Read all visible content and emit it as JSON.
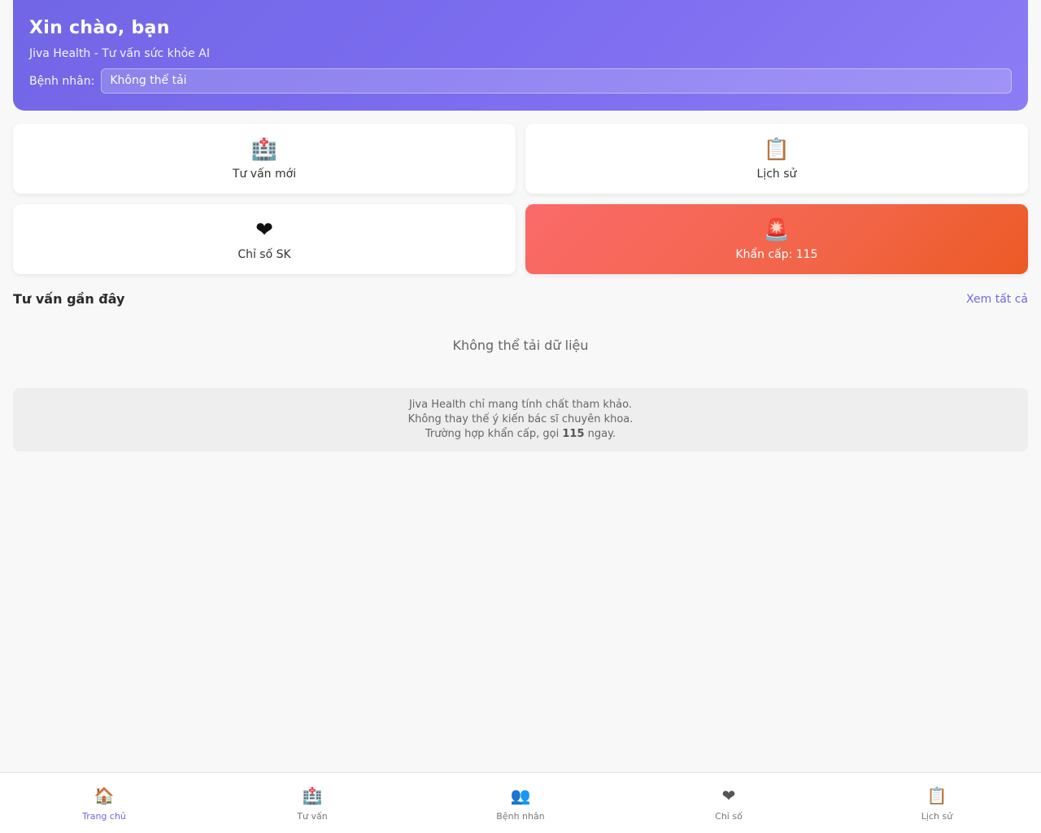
{
  "header": {
    "greeting": "Xin chào, bạn",
    "subtitle": "Jiva Health - Tư vấn sức khỏe AI",
    "patient_label": "Bệnh nhân:",
    "patient_value": "Không thể tải"
  },
  "actions": [
    {
      "icon": "🏥",
      "icon_name": "hospital-icon",
      "label": "Tư vấn mới"
    },
    {
      "icon": "📋",
      "icon_name": "clipboard-icon",
      "label": "Lịch sử"
    },
    {
      "icon": "❤",
      "icon_name": "heart-icon",
      "label": "Chỉ số SK"
    },
    {
      "icon": "🚨",
      "icon_name": "siren-icon",
      "label": "Khẩn cấp: 115"
    }
  ],
  "recent": {
    "title": "Tư vấn gần đây",
    "see_all": "Xem tất cả",
    "empty_message": "Không thể tải dữ liệu"
  },
  "disclaimer": {
    "line1": "Jiva Health chỉ mang tính chất tham khảo.",
    "line2": "Không thay thế ý kiến bác sĩ chuyên khoa.",
    "line3_pre": "Trường hợp khẩn cấp, gọi ",
    "line3_number": "115",
    "line3_post": " ngay."
  },
  "nav": [
    {
      "icon": "🏠",
      "icon_name": "home-icon",
      "label": "Trang chủ",
      "active": true
    },
    {
      "icon": "🏥",
      "icon_name": "hospital-icon",
      "label": "Tư vấn"
    },
    {
      "icon": "👥",
      "icon_name": "patients-icon",
      "label": "Bệnh nhân"
    },
    {
      "icon": "❤",
      "icon_name": "heart-icon",
      "label": "Chỉ số"
    },
    {
      "icon": "📋",
      "icon_name": "clipboard-icon",
      "label": "Lịch sử"
    }
  ],
  "colors": {
    "accent": "#7166e6",
    "emergency": "#ec5a24"
  }
}
